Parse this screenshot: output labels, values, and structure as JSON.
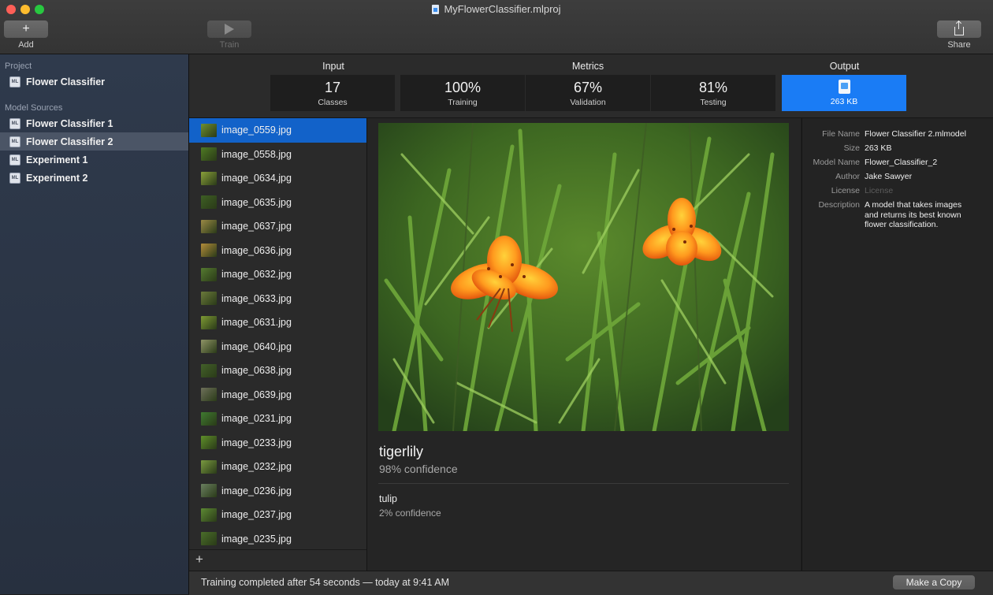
{
  "window": {
    "title": "MyFlowerClassifier.mlproj"
  },
  "toolbar": {
    "add_label": "Add",
    "train_label": "Train",
    "share_label": "Share"
  },
  "sidebar": {
    "project_header": "Project",
    "project_item": "Flower Classifier",
    "sources_header": "Model Sources",
    "sources": [
      {
        "label": "Flower Classifier 1"
      },
      {
        "label": "Flower Classifier 2"
      },
      {
        "label": "Experiment 1"
      },
      {
        "label": "Experiment 2"
      }
    ]
  },
  "summary": {
    "input_header": "Input",
    "metrics_header": "Metrics",
    "output_header": "Output",
    "classes_value": "17",
    "classes_caption": "Classes",
    "training_value": "100%",
    "training_caption": "Training",
    "validation_value": "67%",
    "validation_caption": "Validation",
    "testing_value": "81%",
    "testing_caption": "Testing",
    "output_size": "263 KB"
  },
  "files": [
    "image_0559.jpg",
    "image_0558.jpg",
    "image_0634.jpg",
    "image_0635.jpg",
    "image_0637.jpg",
    "image_0636.jpg",
    "image_0632.jpg",
    "image_0633.jpg",
    "image_0631.jpg",
    "image_0640.jpg",
    "image_0638.jpg",
    "image_0639.jpg",
    "image_0231.jpg",
    "image_0233.jpg",
    "image_0232.jpg",
    "image_0236.jpg",
    "image_0237.jpg",
    "image_0235.jpg"
  ],
  "prediction": {
    "top_label": "tigerlily",
    "top_confidence": "98% confidence",
    "second_label": "tulip",
    "second_confidence": "2% confidence"
  },
  "info": {
    "file_name_key": "File Name",
    "file_name": "Flower Classifier 2.mlmodel",
    "size_key": "Size",
    "size": "263 KB",
    "model_name_key": "Model Name",
    "model_name": "Flower_Classifier_2",
    "author_key": "Author",
    "author": "Jake Sawyer",
    "license_key": "License",
    "license": "License",
    "description_key": "Description",
    "description": "A model that takes images and returns its best known flower classification."
  },
  "status": {
    "text": "Training completed after 54 seconds — today at 9:41 AM",
    "copy_label": "Make a Copy"
  },
  "colors": {
    "accent": "#1a7cf5",
    "selection": "#1262c9",
    "sidebar": "#2f3a4c"
  }
}
